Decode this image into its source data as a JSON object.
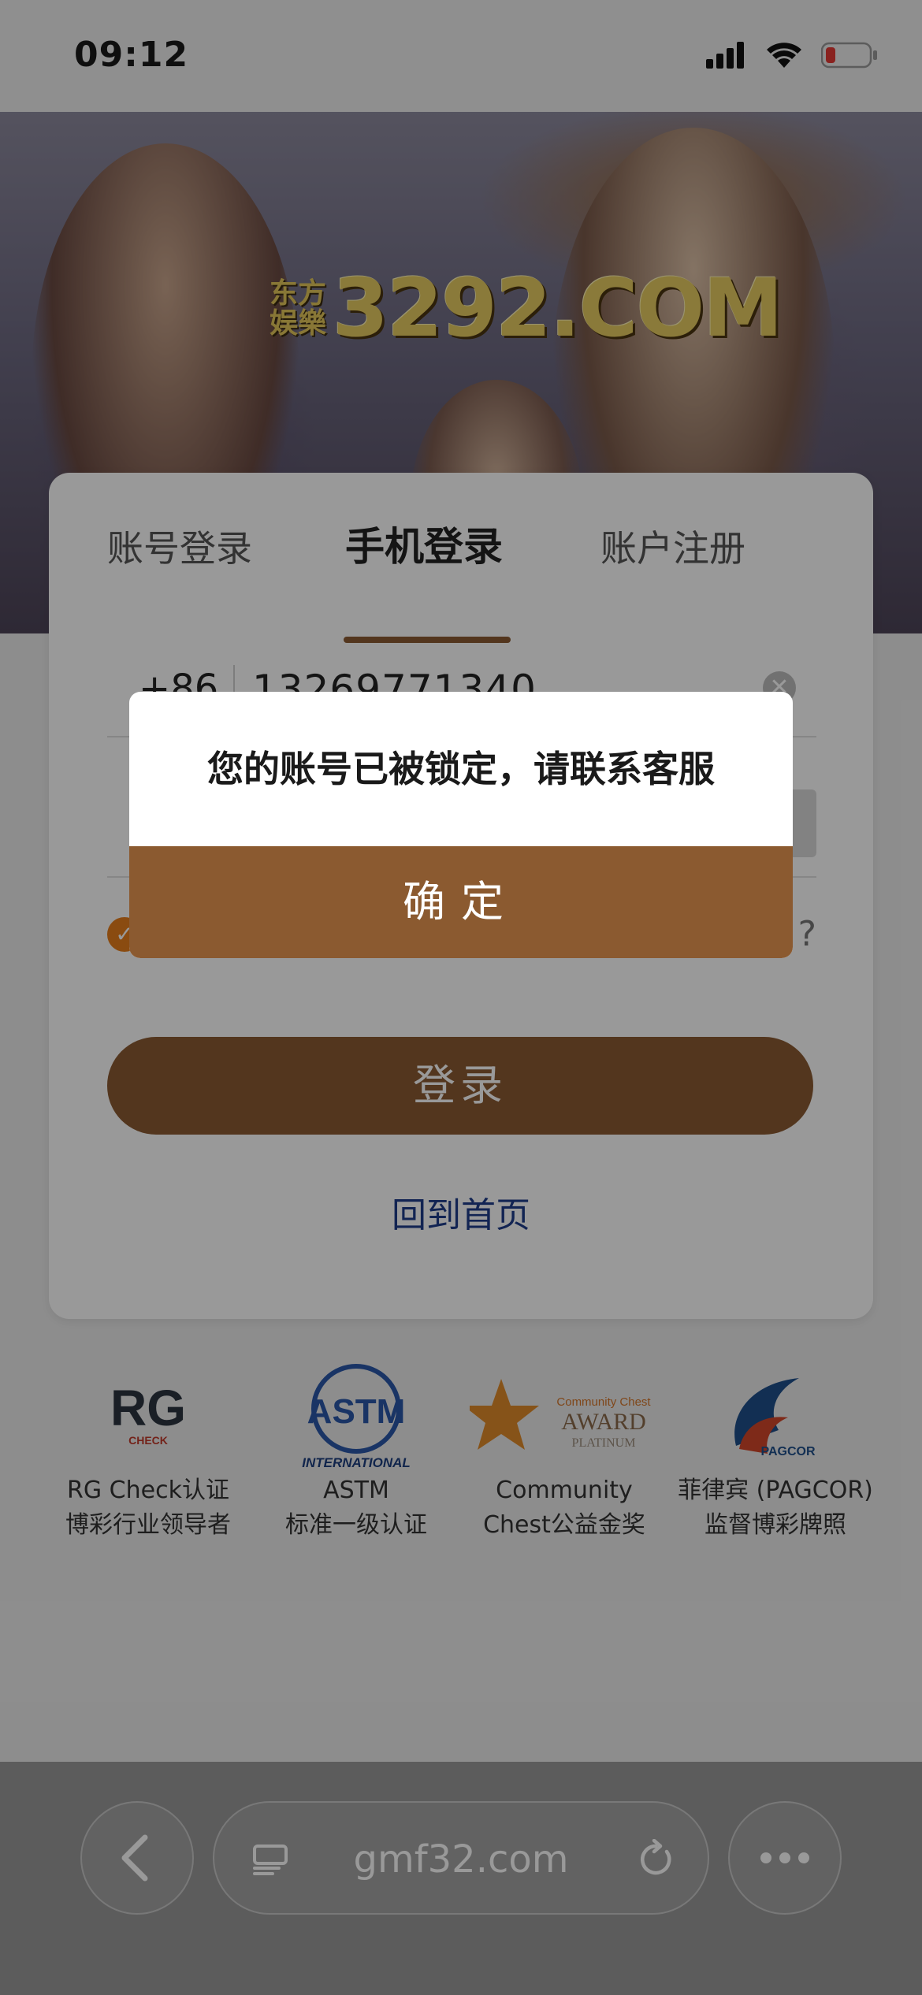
{
  "status_bar": {
    "time": "09:12"
  },
  "banner": {
    "logo_cn_top": "东方",
    "logo_cn_bottom": "娱樂",
    "logo_brand": "3292.COM"
  },
  "login": {
    "tabs": [
      "账号登录",
      "手机登录",
      "账户注册"
    ],
    "active_tab": "手机登录",
    "country_code": "+86",
    "phone_value": "13269771340",
    "forgot_suffix": "?",
    "login_button": "登录",
    "home_link": "回到首页"
  },
  "certifications": [
    {
      "icon": "rg-check-logo",
      "logo_text": "RG",
      "logo_sub": "CHECK",
      "line1": "RG Check认证",
      "line2": "博彩行业领导者"
    },
    {
      "icon": "astm-logo",
      "logo_text": "ASTM",
      "logo_sub": "INTERNATIONAL",
      "line1": "ASTM",
      "line2": "标准一级认证"
    },
    {
      "icon": "community-chest-award-logo",
      "logo_text": "Community Chest",
      "logo_sub": "AWARD",
      "logo_sub2": "PLATINUM",
      "line1": "Community",
      "line2": "Chest公益金奖"
    },
    {
      "icon": "pagcor-logo",
      "logo_text": "PAGCOR",
      "line1": "菲律宾 (PAGCOR)",
      "line2": "监督博彩牌照"
    }
  ],
  "dialog": {
    "message": "您的账号已被锁定，请联系客服",
    "confirm_label": "确定"
  },
  "browser": {
    "url": "gmf32.com"
  },
  "colors": {
    "accent": "#8b5a30",
    "link": "#1e3c8a",
    "check": "#e67e1c"
  }
}
